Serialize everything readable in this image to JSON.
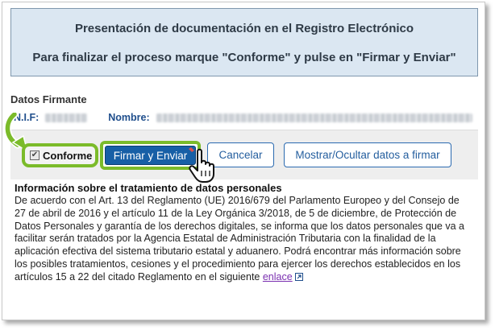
{
  "header": {
    "line1": "Presentación de documentación en el Registro Electrónico",
    "line2": "Para finalizar el proceso marque \"Conforme\" y pulse en \"Firmar y Enviar\""
  },
  "signer": {
    "title": "Datos Firmante",
    "nif_label": "N.I.F:",
    "name_label": "Nombre:"
  },
  "actions": {
    "conforme_label": "Conforme",
    "conforme_checked": true,
    "sign_button": "Firmar y Enviar",
    "cancel_button": "Cancelar",
    "toggle_button": "Mostrar/Ocultar datos a firmar"
  },
  "info": {
    "title": "Información sobre el tratamiento de datos personales",
    "body": "De acuerdo con el Art. 13 del Reglamento (UE) 2016/679 del Parlamento Europeo y del Consejo de 27 de abril de 2016 y el artículo 11 de la Ley Orgánica 3/2018, de 5 de diciembre, de Protección de Datos Personales y garantía de los derechos digitales, se informa que los datos personales que va a facilitar serán tratados por la Agencia Estatal de Administración Tributaria con la finalidad de la aplicación efectiva del sistema tributario estatal y aduanero. Podrá encontrar más información sobre los posibles tratamientos, cesiones y el procedimiento para ejercer los derechos establecidos en los artículos 15 a 22 del citado Reglamento en el siguiente",
    "link_text": "enlace"
  },
  "icons": {
    "checkbox": "check-icon",
    "cursor": "hand-pointer-icon",
    "highlight_arrow": "curved-arrow-icon",
    "external_link": "external-link-icon"
  },
  "colors": {
    "header_bg": "#dbe7f2",
    "primary_button": "#175fa6",
    "highlight": "#7bbb2a",
    "link": "#7a2fb0"
  }
}
